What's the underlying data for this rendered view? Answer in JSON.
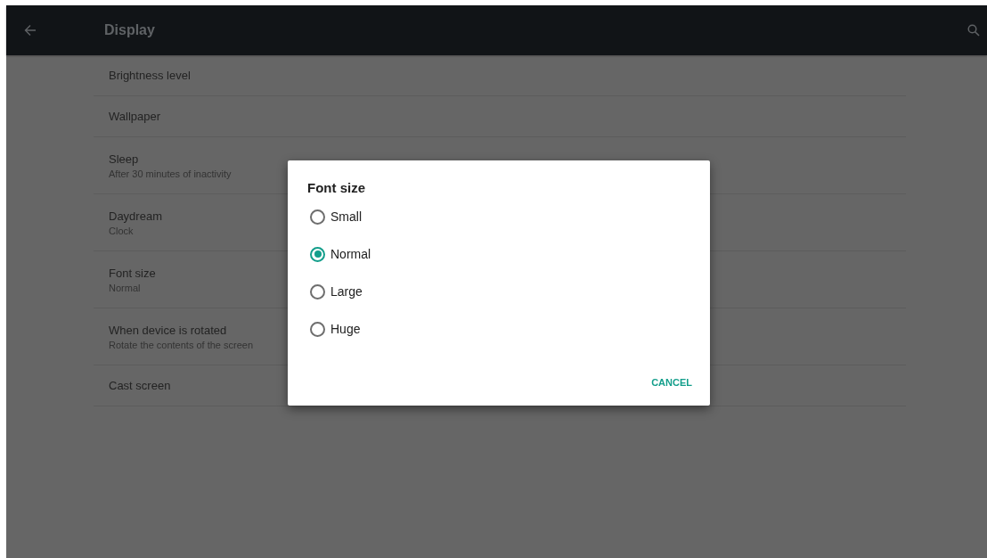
{
  "app_bar": {
    "title": "Display"
  },
  "settings": [
    {
      "title": "Brightness level"
    },
    {
      "title": "Wallpaper"
    },
    {
      "title": "Sleep",
      "summary": "After 30 minutes of inactivity"
    },
    {
      "title": "Daydream",
      "summary": "Clock"
    },
    {
      "title": "Font size",
      "summary": "Normal"
    },
    {
      "title": "When device is rotated",
      "summary": "Rotate the contents of the screen"
    },
    {
      "title": "Cast screen"
    }
  ],
  "dialog": {
    "title": "Font size",
    "options": [
      {
        "label": "Small",
        "selected": false
      },
      {
        "label": "Normal",
        "selected": true
      },
      {
        "label": "Large",
        "selected": false
      },
      {
        "label": "Huge",
        "selected": false
      }
    ],
    "buttons": [
      "CANCEL"
    ]
  }
}
